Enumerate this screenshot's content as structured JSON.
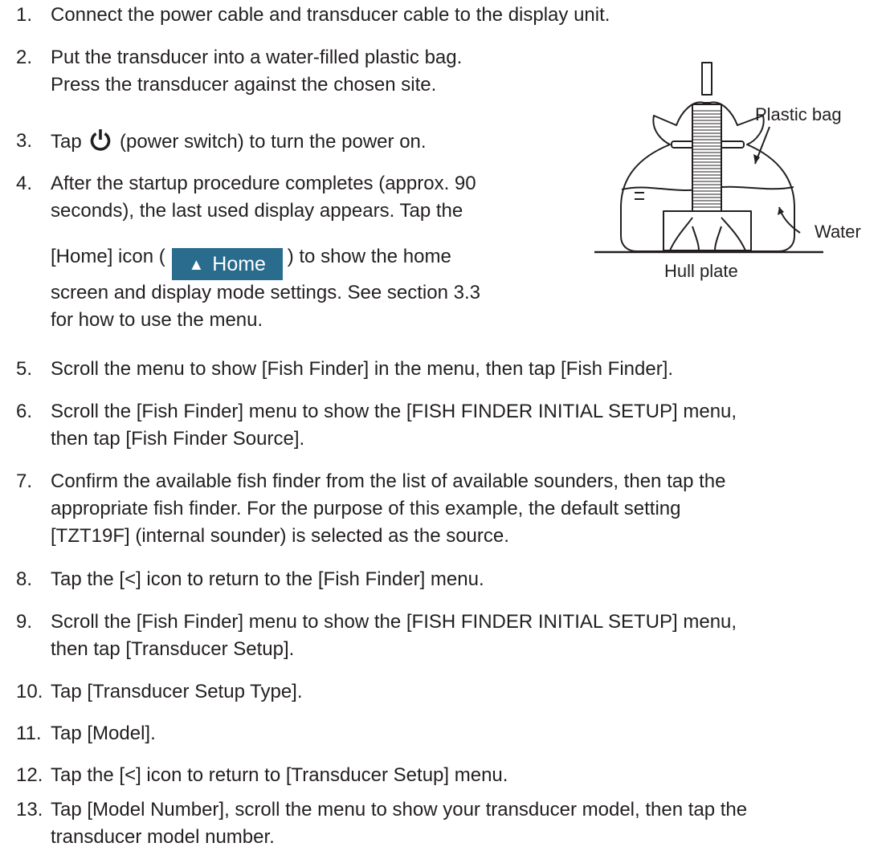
{
  "steps": [
    {
      "num": "1.",
      "lines": [
        "Connect the power cable and transducer cable to the display unit."
      ]
    },
    {
      "num": "2.",
      "lines": [
        "Put the transducer into a water-filled plastic bag.",
        "Press the transducer against the chosen site."
      ]
    },
    {
      "num": "3.",
      "pre": "Tap",
      "post": "(power switch) to turn the power on."
    },
    {
      "num": "4.",
      "lines": [
        "After the startup procedure completes (approx. 90",
        "seconds), the last used display appears. Tap the"
      ],
      "home_pre": "[Home] icon (",
      "home_post": ") to show the home",
      "lines2": [
        "screen and display mode settings. See section 3.3",
        "for how to use the menu."
      ]
    },
    {
      "num": "5.",
      "lines": [
        "Scroll the menu to show [Fish Finder] in the menu, then tap [Fish Finder]."
      ]
    },
    {
      "num": "6.",
      "lines": [
        "Scroll the [Fish Finder] menu to show the [FISH FINDER INITIAL SETUP] menu,",
        "then tap [Fish Finder Source]."
      ]
    },
    {
      "num": "7.",
      "lines": [
        "Confirm the available fish finder from the list of available sounders, then tap the",
        "appropriate fish finder. For the purpose of this example, the default setting",
        "[TZT19F] (internal sounder) is selected as the source."
      ]
    },
    {
      "num": "8.",
      "lines": [
        "Tap the [<] icon to return to the [Fish Finder] menu."
      ]
    },
    {
      "num": "9.",
      "lines": [
        "Scroll the [Fish Finder] menu to show the [FISH FINDER INITIAL SETUP] menu,",
        "then tap [Transducer Setup]."
      ]
    },
    {
      "num": "10.",
      "lines": [
        "Tap [Transducer Setup Type]."
      ]
    },
    {
      "num": "11.",
      "lines": [
        "Tap [Model]."
      ]
    },
    {
      "num": "12.",
      "lines": [
        "Tap the [<] icon to return to [Transducer Setup] menu."
      ]
    },
    {
      "num": "13.",
      "lines": [
        "Tap [Model Number], scroll the menu to show your transducer model, then tap the",
        "transducer model number."
      ]
    }
  ],
  "home_button": {
    "label": "Home",
    "icon": "chevron-up-icon",
    "color": "#2a6c8e"
  },
  "power_icon": "power-icon",
  "figure": {
    "plastic_bag": "Plastic bag",
    "water": "Water",
    "hull_plate": "Hull plate"
  }
}
